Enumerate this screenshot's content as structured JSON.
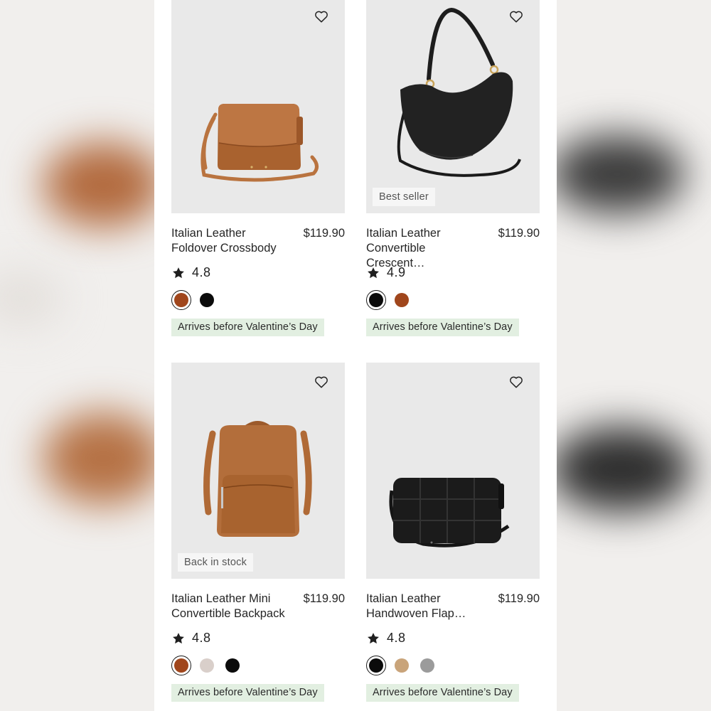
{
  "products": [
    {
      "name": "Italian Leather Foldover Crossbody",
      "price": "$119.90",
      "rating": "4.8",
      "badge": "",
      "delivery": "Arrives before Valentine’s Day",
      "colors": [
        "#a0461c",
        "#0b0b0b"
      ],
      "selected_color": 0
    },
    {
      "name": "Italian Leather Convertible Crescent…",
      "price": "$119.90",
      "rating": "4.9",
      "badge": "Best seller",
      "delivery": "Arrives before Valentine’s Day",
      "colors": [
        "#0b0b0b",
        "#a0461c"
      ],
      "selected_color": 0
    },
    {
      "name": "Italian Leather Mini Convertible Backpack",
      "price": "$119.90",
      "rating": "4.8",
      "badge": "Back in stock",
      "delivery": "Arrives before Valentine’s Day",
      "colors": [
        "#a0461c",
        "#d9cfca",
        "#0b0b0b"
      ],
      "selected_color": 0
    },
    {
      "name": "Italian Leather Handwoven Flap…",
      "price": "$119.90",
      "rating": "4.8",
      "badge": "",
      "delivery": "Arrives before Valentine’s Day",
      "colors": [
        "#0b0b0b",
        "#c9a47a",
        "#9b9b9b"
      ],
      "selected_color": 0
    }
  ],
  "icons": {
    "wishlist": "heart-outline-icon",
    "rating": "star-icon"
  },
  "colors": {
    "delivery_bg": "#e2efe1",
    "photo_bg": "#e9e9e9"
  }
}
